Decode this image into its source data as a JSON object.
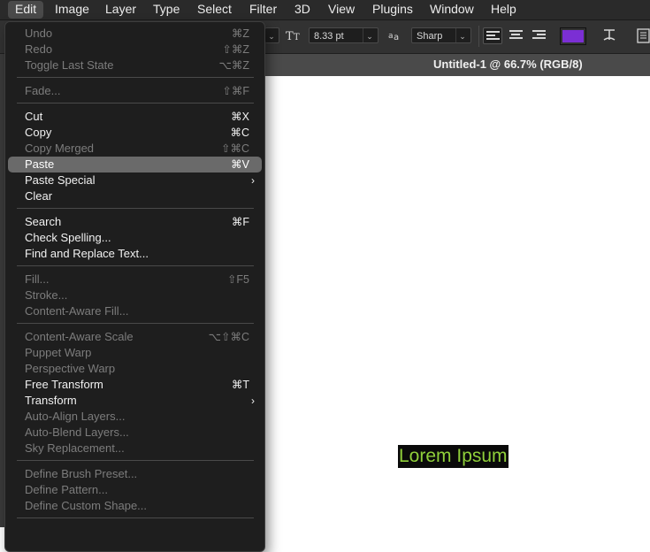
{
  "menubar": {
    "items": [
      {
        "label": "Edit",
        "active": true
      },
      {
        "label": "Image"
      },
      {
        "label": "Layer"
      },
      {
        "label": "Type"
      },
      {
        "label": "Select"
      },
      {
        "label": "Filter"
      },
      {
        "label": "3D"
      },
      {
        "label": "View"
      },
      {
        "label": "Plugins"
      },
      {
        "label": "Window"
      },
      {
        "label": "Help"
      }
    ]
  },
  "options_bar": {
    "font_size_value": "8.33 pt",
    "antialias_value": "Sharp",
    "text_color": "#7b2fd4"
  },
  "document": {
    "tab_title": "Untitled-1 @ 66.7% (RGB/8)",
    "canvas_text": "Lorem Ipsum",
    "canvas_text_color": "#8fcf3a"
  },
  "edit_menu": {
    "items": [
      {
        "label": "Undo",
        "shortcut": "⌘Z",
        "enabled": false
      },
      {
        "label": "Redo",
        "shortcut": "⇧⌘Z",
        "enabled": false
      },
      {
        "label": "Toggle Last State",
        "shortcut": "⌥⌘Z",
        "enabled": false
      },
      {
        "label": "Fade...",
        "shortcut": "⇧⌘F",
        "enabled": false
      },
      {
        "label": "Cut",
        "shortcut": "⌘X",
        "enabled": true
      },
      {
        "label": "Copy",
        "shortcut": "⌘C",
        "enabled": true
      },
      {
        "label": "Copy Merged",
        "shortcut": "⇧⌘C",
        "enabled": false
      },
      {
        "label": "Paste",
        "shortcut": "⌘V",
        "enabled": true,
        "highlighted": true
      },
      {
        "label": "Paste Special",
        "shortcut": "",
        "enabled": true,
        "submenu": true
      },
      {
        "label": "Clear",
        "shortcut": "",
        "enabled": true
      },
      {
        "label": "Search",
        "shortcut": "⌘F",
        "enabled": true
      },
      {
        "label": "Check Spelling...",
        "shortcut": "",
        "enabled": true
      },
      {
        "label": "Find and Replace Text...",
        "shortcut": "",
        "enabled": true
      },
      {
        "label": "Fill...",
        "shortcut": "⇧F5",
        "enabled": false
      },
      {
        "label": "Stroke...",
        "shortcut": "",
        "enabled": false
      },
      {
        "label": "Content-Aware Fill...",
        "shortcut": "",
        "enabled": false
      },
      {
        "label": "Content-Aware Scale",
        "shortcut": "⌥⇧⌘C",
        "enabled": false
      },
      {
        "label": "Puppet Warp",
        "shortcut": "",
        "enabled": false
      },
      {
        "label": "Perspective Warp",
        "shortcut": "",
        "enabled": false
      },
      {
        "label": "Free Transform",
        "shortcut": "⌘T",
        "enabled": true
      },
      {
        "label": "Transform",
        "shortcut": "",
        "enabled": true,
        "submenu": true
      },
      {
        "label": "Auto-Align Layers...",
        "shortcut": "",
        "enabled": false
      },
      {
        "label": "Auto-Blend Layers...",
        "shortcut": "",
        "enabled": false
      },
      {
        "label": "Sky Replacement...",
        "shortcut": "",
        "enabled": false
      },
      {
        "label": "Define Brush Preset...",
        "shortcut": "",
        "enabled": false
      },
      {
        "label": "Define Pattern...",
        "shortcut": "",
        "enabled": false
      },
      {
        "label": "Define Custom Shape...",
        "shortcut": "",
        "enabled": false
      }
    ]
  }
}
